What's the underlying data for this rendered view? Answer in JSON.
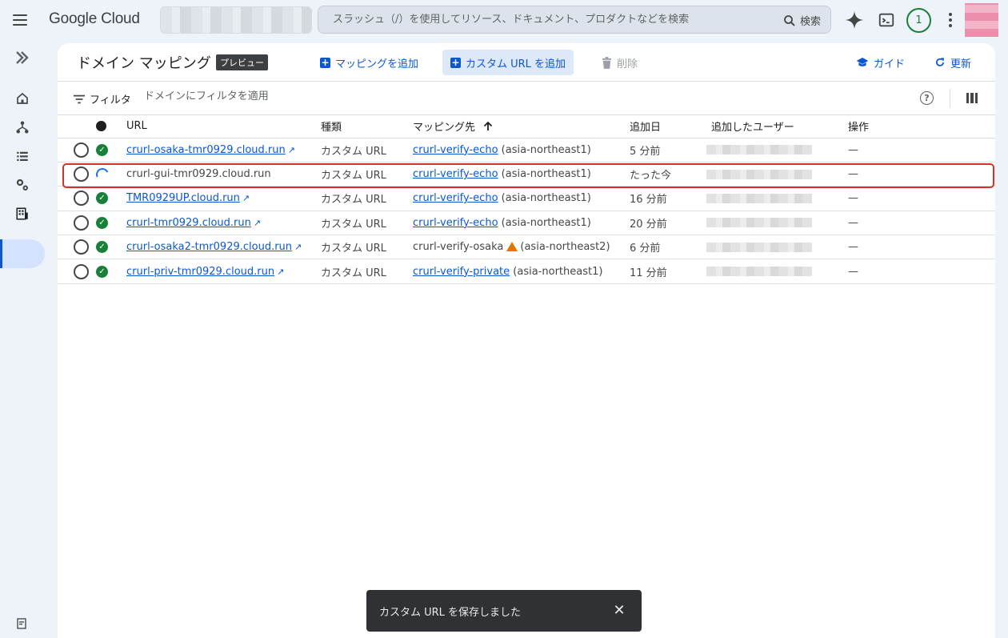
{
  "topbar": {
    "logo": "Google Cloud",
    "search_placeholder": "スラッシュ（/）を使用してリソース、ドキュメント、プロダクトなどを検索",
    "search_button": "検索",
    "notification_count": "1"
  },
  "header": {
    "title": "ドメイン マッピング",
    "badge": "プレビュー",
    "add_mapping": "マッピングを追加",
    "add_custom_url": "カスタム URL を追加",
    "delete": "削除",
    "guide": "ガイド",
    "refresh": "更新"
  },
  "filter": {
    "label": "フィルタ",
    "placeholder": "ドメインにフィルタを適用"
  },
  "table": {
    "columns": [
      "URL",
      "種類",
      "マッピング先",
      "追加日",
      "追加したユーザー",
      "操作"
    ],
    "rows": [
      {
        "status": "ok",
        "url": "crurl-osaka-tmr0929.cloud.run",
        "url_link": true,
        "type": "カスタム URL",
        "target": "crurl-verify-echo",
        "target_link": true,
        "region": "(asia-northeast1)",
        "warn": false,
        "added": "5 分前",
        "action": "—"
      },
      {
        "status": "pending",
        "url": "crurl-gui-tmr0929.cloud.run",
        "url_link": false,
        "type": "カスタム URL",
        "target": "crurl-verify-echo",
        "target_link": true,
        "region": "(asia-northeast1)",
        "warn": false,
        "added": "たった今",
        "action": "—"
      },
      {
        "status": "ok",
        "url": "TMR0929UP.cloud.run",
        "url_link": true,
        "type": "カスタム URL",
        "target": "crurl-verify-echo",
        "target_link": true,
        "region": "(asia-northeast1)",
        "warn": false,
        "added": "16 分前",
        "action": "—"
      },
      {
        "status": "ok",
        "url": "crurl-tmr0929.cloud.run",
        "url_link": true,
        "type": "カスタム URL",
        "target": "crurl-verify-echo",
        "target_link": true,
        "region": "(asia-northeast1)",
        "warn": false,
        "added": "20 分前",
        "action": "—"
      },
      {
        "status": "ok",
        "url": "crurl-osaka2-tmr0929.cloud.run",
        "url_link": true,
        "type": "カスタム URL",
        "target": "crurl-verify-osaka",
        "target_link": false,
        "region": "(asia-northeast2)",
        "warn": true,
        "added": "6 分前",
        "action": "—"
      },
      {
        "status": "ok",
        "url": "crurl-priv-tmr0929.cloud.run",
        "url_link": true,
        "type": "カスタム URL",
        "target": "crurl-verify-private",
        "target_link": true,
        "region": "(asia-northeast1)",
        "warn": false,
        "added": "11 分前",
        "action": "—"
      }
    ]
  },
  "toast": {
    "message": "カスタム URL を保存しました"
  },
  "colors": {
    "accent": "#0b57d0",
    "success": "#188038",
    "highlight": "#d93025",
    "warning": "#e37400"
  }
}
